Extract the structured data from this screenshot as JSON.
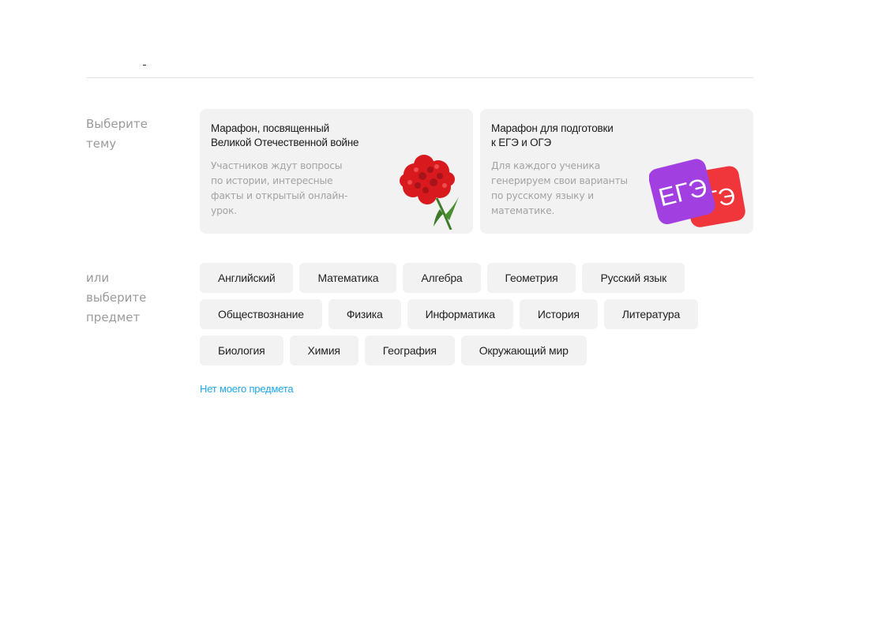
{
  "theme_section": {
    "label": "Выберите\nтему",
    "cards": [
      {
        "title_lines": [
          "Марафон, посвященный",
          "Великой Отечественной войне"
        ],
        "desc_lines": [
          "Участников ждут вопросы",
          "по истории, интересные",
          "факты и открытый онлайн-",
          "урок."
        ],
        "art_icon": "carnation-flower-icon"
      },
      {
        "title_lines": [
          "Марафон для подготовки",
          "к ЕГЭ и ОГЭ"
        ],
        "desc_lines": [
          "Для каждого ученика",
          "генерируем свои варианты",
          "по русскому языку и",
          "математике."
        ],
        "art_icon": "ege-oge-badges-icon",
        "badge_ege": "ЕГЭ",
        "badge_oge": "ОГЭ"
      }
    ]
  },
  "subject_section": {
    "label": "или\nвыберите\nпредмет",
    "rows": [
      [
        "Английский",
        "Математика",
        "Алгебра",
        "Геометрия",
        "Русский язык"
      ],
      [
        "Обществознание",
        "Физика",
        "Информатика",
        "История",
        "Литература"
      ],
      [
        "Биология",
        "Химия",
        "География",
        "Окружающий мир"
      ]
    ],
    "no_subject_link": "Нет моего предмета"
  },
  "colors": {
    "card_bg": "#f2f2f2",
    "link": "#1fa6e8",
    "label": "#9b9b9b",
    "ege_badge": "#a23fe0",
    "oge_badge": "#f0353b",
    "flower": "#d81a1f"
  }
}
